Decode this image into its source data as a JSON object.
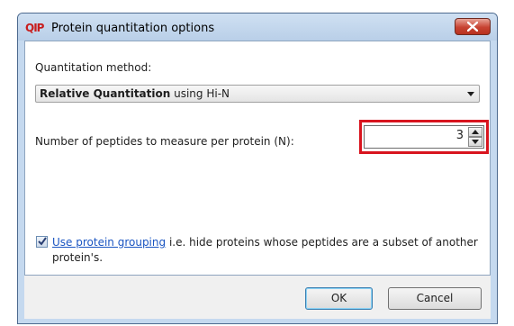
{
  "window": {
    "app_icon_text": "QIP",
    "title": "Protein quantitation options"
  },
  "quantitation": {
    "label": "Quantitation method:",
    "selected_bold": "Relative Quantitation",
    "selected_rest": " using Hi-N"
  },
  "peptides": {
    "label": "Number of peptides to measure per protein (N):",
    "value": "3"
  },
  "grouping": {
    "checked": true,
    "link_text": "Use protein grouping",
    "description": " i.e. hide proteins whose peptides are a subset of another protein's."
  },
  "buttons": {
    "ok": "OK",
    "cancel": "Cancel"
  },
  "colors": {
    "highlight": "#d8141e",
    "link": "#1a55c2",
    "close_button": "#c74232"
  }
}
